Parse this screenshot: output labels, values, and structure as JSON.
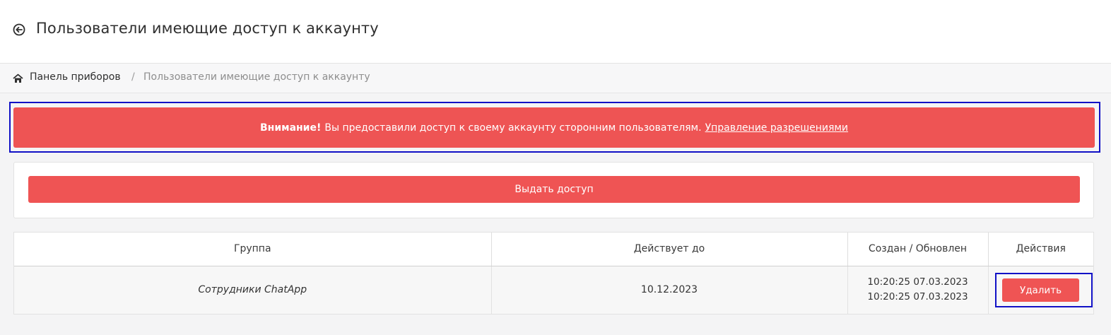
{
  "header": {
    "back_icon": "arrow-left-circle-icon",
    "title": "Пользователи имеющие доступ к аккаунту"
  },
  "breadcrumb": {
    "home_icon": "home-icon",
    "home": "Панель приборов",
    "separator": "/",
    "current": "Пользователи имеющие доступ к аккаунту"
  },
  "alert": {
    "strong": "Внимание!",
    "text": "Вы предоставили доступ к своему аккаунту сторонним пользователям.",
    "link": "Управление разрешениями",
    "color": "#ee5454"
  },
  "actions": {
    "grant_label": "Выдать доступ"
  },
  "table": {
    "columns": [
      "Группа",
      "Действует до",
      "Создан / Обновлен",
      "Действия"
    ],
    "rows": [
      {
        "group": "Сотрудники ChatApp",
        "valid_until": "10.12.2023",
        "created": "10:20:25 07.03.2023",
        "updated": "10:20:25 07.03.2023",
        "delete_label": "Удалить"
      }
    ]
  },
  "colors": {
    "accent": "#ef5454",
    "highlight_outline": "#1111c6"
  }
}
